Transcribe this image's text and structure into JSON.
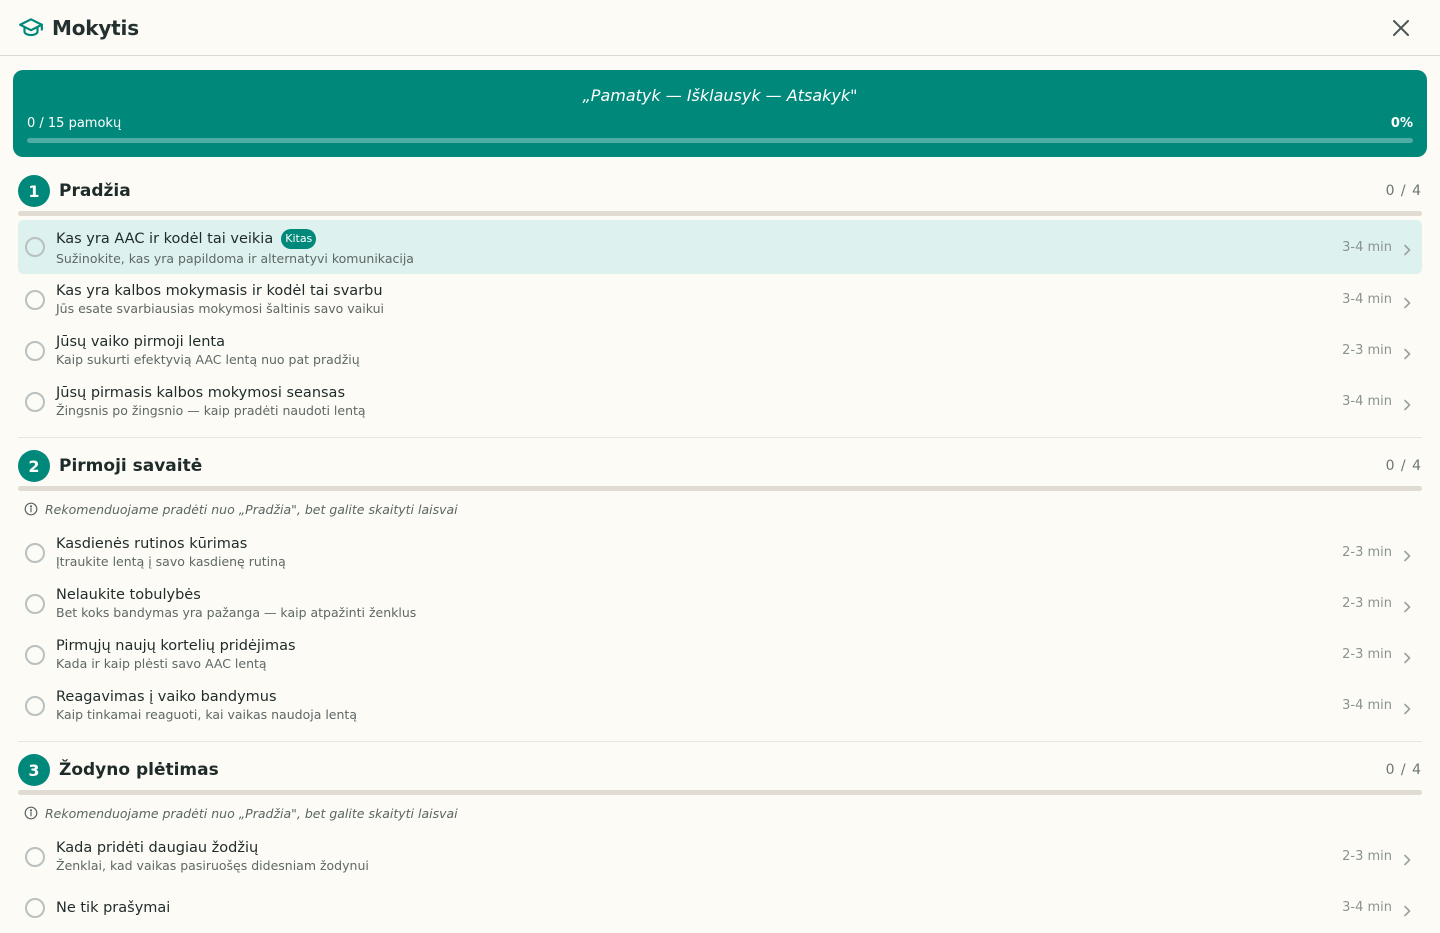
{
  "app": {
    "title": "Mokytis"
  },
  "banner": {
    "quote": "„Pamatyk — Išklausyk — Atsakyk\"",
    "progress_text": "0 / 15 pamokų",
    "percent_text": "0%",
    "progress_fraction": 0
  },
  "hint_text": "Rekomenduojame pradėti nuo „Pradžia\", bet galite skaityti laisvai",
  "sections": [
    {
      "number": "1",
      "title": "Pradžia",
      "count": "0 / 4",
      "lessons": [
        {
          "title": "Kas yra AAC ir kodėl tai veikia",
          "badge": "Kitas",
          "subtitle": "Sužinokite, kas yra papildoma ir alternatyvi komunikacija",
          "duration": "3-4 min"
        },
        {
          "title": "Kas yra kalbos mokymasis ir kodėl tai svarbu",
          "subtitle": "Jūs esate svarbiausias mokymosi šaltinis savo vaikui",
          "duration": "3-4 min"
        },
        {
          "title": "Jūsų vaiko pirmoji lenta",
          "subtitle": "Kaip sukurti efektyvią AAC lentą nuo pat pradžių",
          "duration": "2-3 min"
        },
        {
          "title": "Jūsų pirmasis kalbos mokymosi seansas",
          "subtitle": "Žingsnis po žingsnio — kaip pradėti naudoti lentą",
          "duration": "3-4 min"
        }
      ]
    },
    {
      "number": "2",
      "title": "Pirmoji savaitė",
      "count": "0 / 4",
      "lessons": [
        {
          "title": "Kasdienės rutinos kūrimas",
          "subtitle": "Įtraukite lentą į savo kasdienę rutiną",
          "duration": "2-3 min"
        },
        {
          "title": "Nelaukite tobulybės",
          "subtitle": "Bet koks bandymas yra pažanga — kaip atpažinti ženklus",
          "duration": "2-3 min"
        },
        {
          "title": "Pirmųjų naujų kortelių pridėjimas",
          "subtitle": "Kada ir kaip plėsti savo AAC lentą",
          "duration": "2-3 min"
        },
        {
          "title": "Reagavimas į vaiko bandymus",
          "subtitle": "Kaip tinkamai reaguoti, kai vaikas naudoja lentą",
          "duration": "3-4 min"
        }
      ]
    },
    {
      "number": "3",
      "title": "Žodyno plėtimas",
      "count": "0 / 4",
      "lessons": [
        {
          "title": "Kada pridėti daugiau žodžių",
          "subtitle": "Ženklai, kad vaikas pasiruošęs didesniam žodynui",
          "duration": "2-3 min"
        },
        {
          "title": "Ne tik prašymai",
          "subtitle": "",
          "duration": "3-4 min"
        }
      ]
    }
  ]
}
